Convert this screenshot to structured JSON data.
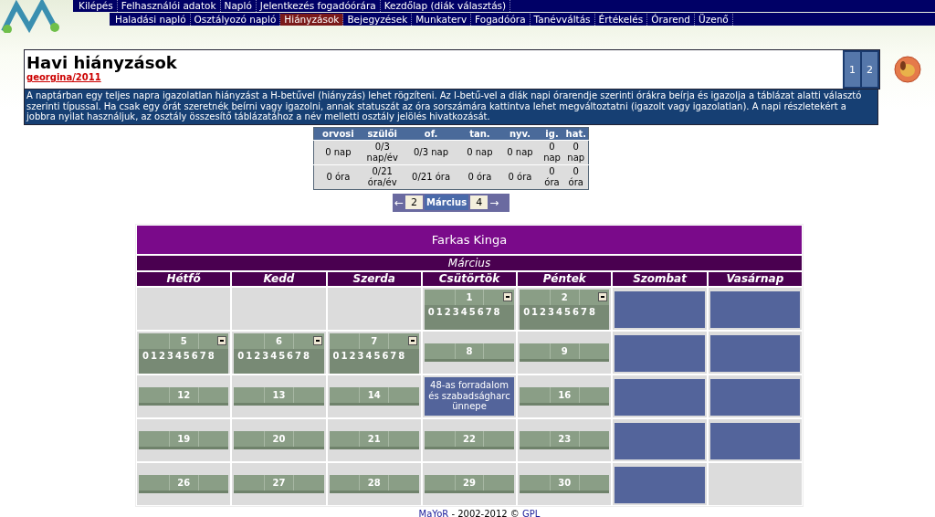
{
  "menu_primary": [
    "Kilépés",
    "Felhasználói adatok",
    "Napló",
    "Jelentkezés fogadóórára",
    "Kezdőlap (diák választás)"
  ],
  "menu_secondary": [
    {
      "label": "Haladási napló",
      "selected": false
    },
    {
      "label": "Osztályozó napló",
      "selected": false
    },
    {
      "label": "Hiányzások",
      "selected": true
    },
    {
      "label": "Bejegyzések",
      "selected": false
    },
    {
      "label": "Munkaterv",
      "selected": false
    },
    {
      "label": "Fogadóóra",
      "selected": false
    },
    {
      "label": "Tanévváltás",
      "selected": false
    },
    {
      "label": "Értékelés",
      "selected": false
    },
    {
      "label": "Órarend",
      "selected": false
    },
    {
      "label": "Üzenő",
      "selected": false
    }
  ],
  "page": {
    "title": "Havi hiányzások",
    "user_link": "georgina/2011",
    "page_tabs": [
      "1",
      "2"
    ],
    "description": "A naptárban egy teljes napra igazolatlan hiányzást a H-betűvel (hiányzás) lehet rögzíteni. Az I-betű-vel a diák napi órarendje szerinti órákra beírja és igazolja a táblázat alatti választó szerinti típussal. Ha csak egy órát szeretnék beírni vagy igazolni, annak statuszát az óra sorszámára kattintva lehet megváltoztatni (igazolt vagy igazolatlan). A napi részletekért a jobbra nyilat használjuk, az osztály összesítő táblázatához a név melletti osztály jelölés hivatkozását."
  },
  "stats": {
    "columns": [
      "orvosi",
      "szülői",
      "of.",
      "tan.",
      "nyv.",
      "ig.",
      "hat."
    ],
    "rows": [
      [
        "0 nap",
        "0/3 nap/év",
        "0/3 nap",
        "0 nap",
        "0 nap",
        "0 nap",
        "0 nap"
      ],
      [
        "0 óra",
        "0/21 óra/év",
        "0/21 óra",
        "0 óra",
        "0 óra",
        "0 óra",
        "0 óra"
      ]
    ]
  },
  "month_nav": {
    "prev_arrow": "←",
    "prev": "2",
    "current": "Március",
    "next": "4",
    "next_arrow": "→"
  },
  "calendar": {
    "student": "Farkas Kinga",
    "month": "Március",
    "weekdays": [
      "Hétfő",
      "Kedd",
      "Szerda",
      "Csütörtök",
      "Péntek",
      "Szombat",
      "Vasárnap"
    ],
    "weeks": [
      [
        {
          "kind": "empty"
        },
        {
          "kind": "empty"
        },
        {
          "kind": "empty"
        },
        {
          "kind": "day",
          "day": "1",
          "expanded": true,
          "periods": [
            "0",
            "1",
            "2",
            "3",
            "4",
            "5",
            "6",
            "7",
            "8"
          ]
        },
        {
          "kind": "day",
          "day": "2",
          "expanded": true,
          "periods": [
            "0",
            "1",
            "2",
            "3",
            "4",
            "5",
            "6",
            "7",
            "8"
          ]
        },
        {
          "kind": "weekend"
        },
        {
          "kind": "weekend"
        }
      ],
      [
        {
          "kind": "day",
          "day": "5",
          "expanded": true,
          "periods": [
            "0",
            "1",
            "2",
            "3",
            "4",
            "5",
            "6",
            "7",
            "8"
          ]
        },
        {
          "kind": "day",
          "day": "6",
          "expanded": true,
          "periods": [
            "0",
            "1",
            "2",
            "3",
            "4",
            "5",
            "6",
            "7",
            "8"
          ]
        },
        {
          "kind": "day",
          "day": "7",
          "expanded": true,
          "periods": [
            "0",
            "1",
            "2",
            "3",
            "4",
            "5",
            "6",
            "7",
            "8"
          ]
        },
        {
          "kind": "day",
          "day": "8",
          "expanded": false
        },
        {
          "kind": "day",
          "day": "9",
          "expanded": false
        },
        {
          "kind": "weekend"
        },
        {
          "kind": "weekend"
        }
      ],
      [
        {
          "kind": "day",
          "day": "12",
          "expanded": false
        },
        {
          "kind": "day",
          "day": "13",
          "expanded": false
        },
        {
          "kind": "day",
          "day": "14",
          "expanded": false
        },
        {
          "kind": "holiday",
          "text": "48-as forradalom és szabadságharc ünnepe"
        },
        {
          "kind": "day",
          "day": "16",
          "expanded": false
        },
        {
          "kind": "weekend"
        },
        {
          "kind": "weekend"
        }
      ],
      [
        {
          "kind": "day",
          "day": "19",
          "expanded": false
        },
        {
          "kind": "day",
          "day": "20",
          "expanded": false
        },
        {
          "kind": "day",
          "day": "21",
          "expanded": false
        },
        {
          "kind": "day",
          "day": "22",
          "expanded": false
        },
        {
          "kind": "day",
          "day": "23",
          "expanded": false
        },
        {
          "kind": "weekend"
        },
        {
          "kind": "weekend"
        }
      ],
      [
        {
          "kind": "day",
          "day": "26",
          "expanded": false
        },
        {
          "kind": "day",
          "day": "27",
          "expanded": false
        },
        {
          "kind": "day",
          "day": "28",
          "expanded": false
        },
        {
          "kind": "day",
          "day": "29",
          "expanded": false
        },
        {
          "kind": "day",
          "day": "30",
          "expanded": false
        },
        {
          "kind": "weekend"
        },
        {
          "kind": "empty"
        }
      ]
    ]
  },
  "footer": {
    "app_link": "MaYoR",
    "text": " - 2002-2012 © ",
    "license_link": "GPL"
  }
}
